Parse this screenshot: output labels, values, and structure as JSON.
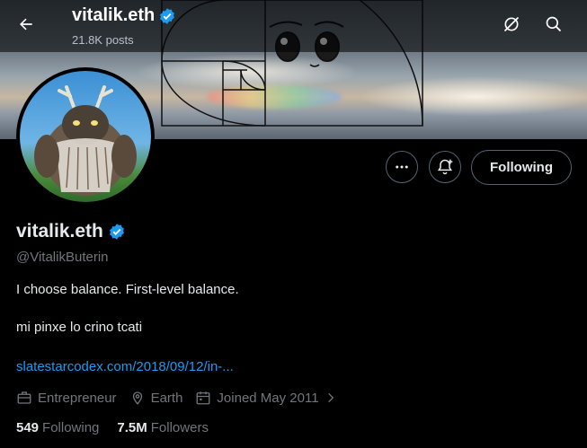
{
  "header": {
    "title": "vitalik.eth",
    "posts": "21.8K posts"
  },
  "profile": {
    "name": "vitalik.eth",
    "handle": "@VitalikButerin",
    "bio_line1": "I choose balance. First-level balance.",
    "bio_line2": "mi pinxe lo crino tcati",
    "link": "slatestarcodex.com/2018/09/12/in-...",
    "profession": "Entrepreneur",
    "location": "Earth",
    "joined": "Joined May 2011",
    "following_count": "549",
    "following_label": "Following",
    "followers_count": "7.5M",
    "followers_label": "Followers"
  },
  "actions": {
    "follow_label": "Following"
  },
  "icons": {
    "back": "arrow-left-icon",
    "grok": "grok-icon",
    "search": "search-icon",
    "more": "more-icon",
    "notify": "bell-plus-icon",
    "verified": "verified-badge-icon",
    "briefcase": "briefcase-icon",
    "location": "location-pin-icon",
    "calendar": "calendar-icon"
  },
  "colors": {
    "accent": "#1d9bf0",
    "muted": "#71767b",
    "text": "#e7e9ea",
    "background": "#000000"
  }
}
